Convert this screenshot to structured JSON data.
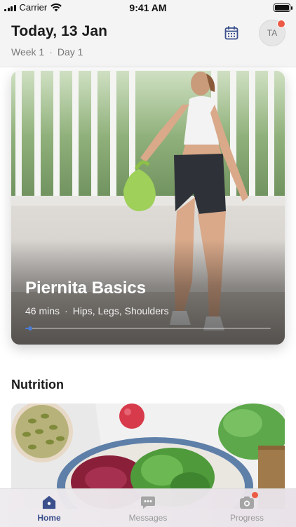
{
  "status_bar": {
    "carrier": "Carrier",
    "time": "9:41 AM",
    "icons": [
      "signal-icon",
      "wifi-icon",
      "battery-icon"
    ],
    "battery_level": 1.0
  },
  "header": {
    "title": "Today, 13 Jan",
    "week": "Week 1",
    "separator": "·",
    "day": "Day 1",
    "calendar_icon": "calendar-icon",
    "avatar_initials": "TA",
    "avatar_has_notification": true
  },
  "workout": {
    "title": "Piernita Basics",
    "duration": "46 mins",
    "separator": "·",
    "focus": "Hips, Legs, Shoulders",
    "progress": 0.02
  },
  "nutrition": {
    "section_title": "Nutrition"
  },
  "tab_bar": {
    "tabs": [
      {
        "label": "Home",
        "icon": "home-icon",
        "active": true
      },
      {
        "label": "Messages",
        "icon": "message-icon",
        "active": false
      },
      {
        "label": "Progress",
        "icon": "camera-icon",
        "active": false,
        "badge": true
      }
    ]
  },
  "colors": {
    "accent": "#3b4f8c",
    "badge": "#ec5a45",
    "progress": "#4a7bd1"
  }
}
